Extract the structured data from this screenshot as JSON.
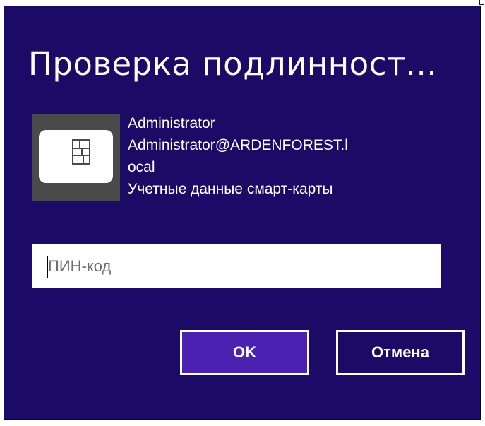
{
  "dialog": {
    "title": "Проверка подлинност...",
    "background_color": "#1b0a66"
  },
  "credential": {
    "icon": "smart-card-icon",
    "user_name": "Administrator",
    "upn_line1": "Administrator@ARDENFOREST.l",
    "upn_line2": "ocal",
    "credential_type": "Учетные данные смарт-карты"
  },
  "pin": {
    "placeholder": "ПИН-код",
    "value": ""
  },
  "buttons": {
    "ok_label": "OK",
    "ok_color": "#4b21b1",
    "cancel_label": "Отмена"
  }
}
